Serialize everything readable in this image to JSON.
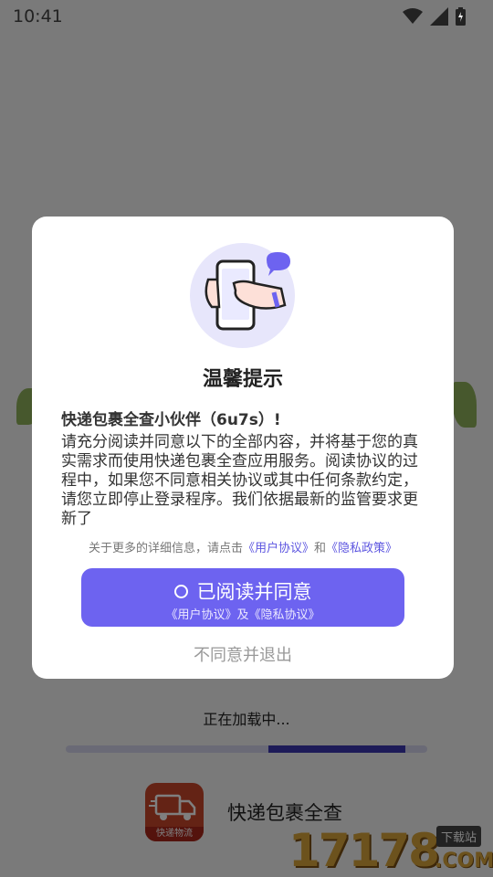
{
  "status_bar": {
    "time": "10:41",
    "icons": [
      "wifi-icon",
      "signal-icon",
      "battery-icon"
    ]
  },
  "background": {
    "loading_text": "正在加载中...",
    "progress": 0.4,
    "app_name": "快递包裹全查",
    "app_logo_text": "快递物流"
  },
  "watermark": {
    "number": "17178",
    "tag": "下载站",
    "com": ".COM"
  },
  "dialog": {
    "title": "温馨提示",
    "greeting": "快递包裹全查小伙伴（6u7s）!",
    "body": "请充分阅读并同意以下的全部内容，并将基于您的真实需求而使用快递包裹全查应用服务。阅读协议的过程中，如果您不同意相关协议或其中任何条款约定，请您立即停止登录程序。我们依据最新的监管要求更新了",
    "more_info_prefix": "关于更多的详细信息，请点击",
    "user_agreement_link": "《用户协议》",
    "and_text": "和",
    "privacy_policy_link": "《隐私政策》",
    "agree_label": "已阅读并同意",
    "agree_sub": "《用户协议》及《隐私协议》",
    "decline_label": "不同意并退出"
  },
  "colors": {
    "accent": "#6d63f0",
    "link": "#5d56e0",
    "progress_fill": "#3a36b0"
  }
}
